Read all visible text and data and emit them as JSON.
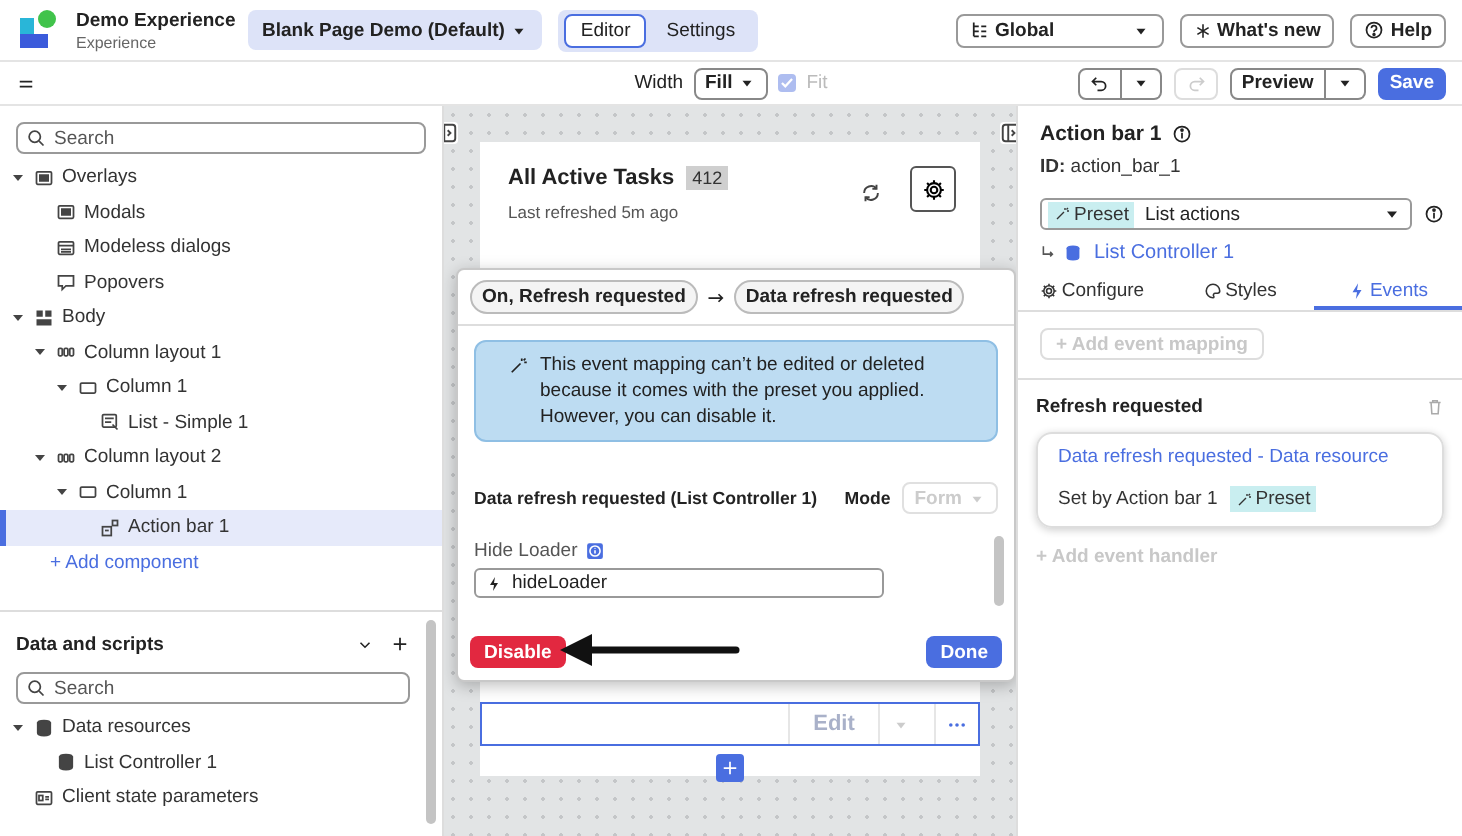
{
  "header": {
    "app_title": "Demo Experience",
    "app_subtitle": "Experience",
    "page_menu": "Blank Page Demo (Default)",
    "mode_tabs": [
      {
        "label": "Editor",
        "selected": true
      },
      {
        "label": "Settings",
        "selected": false
      }
    ],
    "scope_menu": "Global",
    "whats_new": "What's new",
    "help": "Help"
  },
  "toolbar": {
    "width_label": "Width",
    "width_value": "Fill",
    "fit": {
      "label": "Fit",
      "checked": true,
      "disabled": true
    },
    "redo": {
      "disabled": true
    },
    "preview": "Preview",
    "save": "Save"
  },
  "outline": {
    "search": {
      "placeholder": "Search"
    },
    "tree": [
      {
        "label": "Overlays",
        "kind": "overlays",
        "expanded": true,
        "selected": false,
        "children": [
          {
            "label": "Modals",
            "kind": "modal",
            "selected": false
          },
          {
            "label": "Modeless dialogs",
            "kind": "modeless",
            "selected": false
          },
          {
            "label": "Popovers",
            "kind": "popover",
            "selected": false
          }
        ]
      },
      {
        "label": "Body",
        "kind": "body",
        "expanded": true,
        "selected": false,
        "children": [
          {
            "label": "Column layout 1",
            "kind": "columns",
            "expanded": true,
            "selected": false,
            "children": [
              {
                "label": "Column 1",
                "kind": "column",
                "expanded": true,
                "selected": false,
                "children": [
                  {
                    "label": "List - Simple 1",
                    "kind": "list",
                    "selected": false
                  }
                ]
              }
            ]
          },
          {
            "label": "Column layout 2",
            "kind": "columns",
            "expanded": true,
            "selected": false,
            "children": [
              {
                "label": "Column 1",
                "kind": "column",
                "expanded": true,
                "selected": false,
                "children": [
                  {
                    "label": "Action bar 1",
                    "kind": "action_bar",
                    "selected": true
                  }
                ]
              }
            ]
          }
        ]
      }
    ],
    "add_component": "+ Add component"
  },
  "data_scripts": {
    "title": "Data and scripts",
    "search": {
      "placeholder": "Search"
    },
    "tree": [
      {
        "label": "Data resources",
        "kind": "database",
        "expanded": true,
        "selected": false,
        "children": [
          {
            "label": "List Controller 1",
            "kind": "database",
            "selected": false
          }
        ]
      },
      {
        "label": "Client state parameters",
        "kind": "client_state",
        "selected": false
      }
    ]
  },
  "canvas": {
    "card": {
      "title": "All Active Tasks",
      "count": "412",
      "subtitle": "Last refreshed 5m ago"
    },
    "action_bar": {
      "edit": {
        "label": "Edit",
        "disabled": true
      }
    }
  },
  "popover": {
    "trigger": "On, Refresh requested",
    "target": "Data refresh requested",
    "notice": "This event mapping can’t be edited or deleted because it comes with the preset you applied. However, you can disable it.",
    "section_title": "Data refresh requested (List Controller 1)",
    "mode": {
      "label": "Mode",
      "value": "Form",
      "disabled": true
    },
    "fields": [
      {
        "label": "Hide Loader",
        "value": "hideLoader"
      }
    ],
    "disable": "Disable",
    "done": "Done"
  },
  "properties": {
    "title": "Action bar 1",
    "id": "**ID:** action_bar_1",
    "preset": {
      "badge": "Preset",
      "value": "List actions"
    },
    "controller_link": "List Controller 1",
    "tabs": [
      {
        "label": "Configure",
        "kind": "configure",
        "selected": false
      },
      {
        "label": "Styles",
        "kind": "styles",
        "selected": false
      },
      {
        "label": "Events",
        "kind": "events",
        "selected": true
      }
    ],
    "add_event_mapping": {
      "label": "+ Add event mapping",
      "disabled": true
    },
    "events": [
      {
        "title": "Refresh requested",
        "handlers": [
          {
            "action": "Data refresh requested - Data resource",
            "set_by": "Set by Action bar 1",
            "badge": "Preset"
          }
        ]
      }
    ],
    "add_event_handler": {
      "label": "+ Add event handler",
      "disabled": true
    }
  }
}
